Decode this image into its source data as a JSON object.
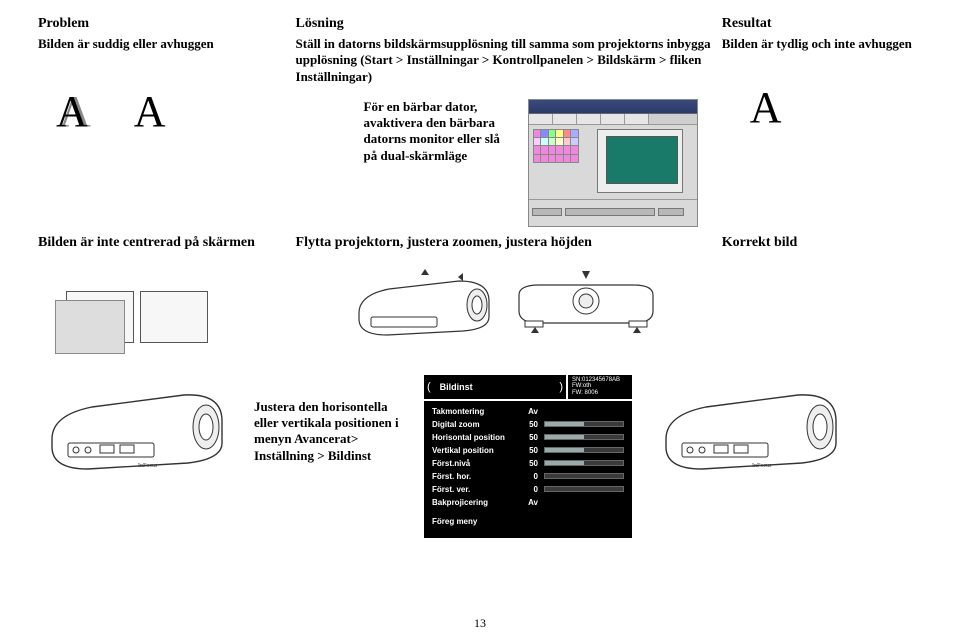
{
  "headers": {
    "problem": "Problem",
    "solution": "Lösning",
    "result": "Resultat"
  },
  "section1": {
    "problem": "Bilden är suddig eller avhuggen",
    "solution_main": "Ställ in datorns bildskärmsupplösning till samma som projektorns inbygga upplösning (Start > Inställningar > Kontrollpanelen > Bildskärm > fliken Inställningar)",
    "laptop_note": "För en bärbar dator, avaktivera den bärbara datorns monitor eller slå på dual-skärmläge",
    "result": "Bilden är tydlig och inte avhuggen",
    "glyph_blur": "A",
    "glyph_clean": "A",
    "glyph_result": "A"
  },
  "section2": {
    "problem": "Bilden är inte centrerad på skärmen",
    "solution": "Flytta projektorn, justera zoomen, justera höjden",
    "result": "Korrekt bild",
    "adjust_note": "Justera den horisontella eller vertikala positionen i menyn Avancerat> Inställning > Bildinst"
  },
  "osd": {
    "title": "Bildinst",
    "info1": "SN:012345678AB",
    "info2": "FW:oth",
    "info3": "FW: 8006",
    "rows": [
      {
        "label": "Takmontering",
        "value": "Av",
        "bar": null
      },
      {
        "label": "Digital zoom",
        "value": "50",
        "bar": 50
      },
      {
        "label": "Horisontal position",
        "value": "50",
        "bar": 50
      },
      {
        "label": "Vertikal position",
        "value": "50",
        "bar": 50
      },
      {
        "label": "Först.nivå",
        "value": "50",
        "bar": 50
      },
      {
        "label": "Först. hor.",
        "value": "0",
        "bar": 0
      },
      {
        "label": "Först. ver.",
        "value": "0",
        "bar": 0
      },
      {
        "label": "Bakprojicering",
        "value": "Av",
        "bar": null
      }
    ],
    "prev": "Föreg meny"
  },
  "page_number": "13"
}
